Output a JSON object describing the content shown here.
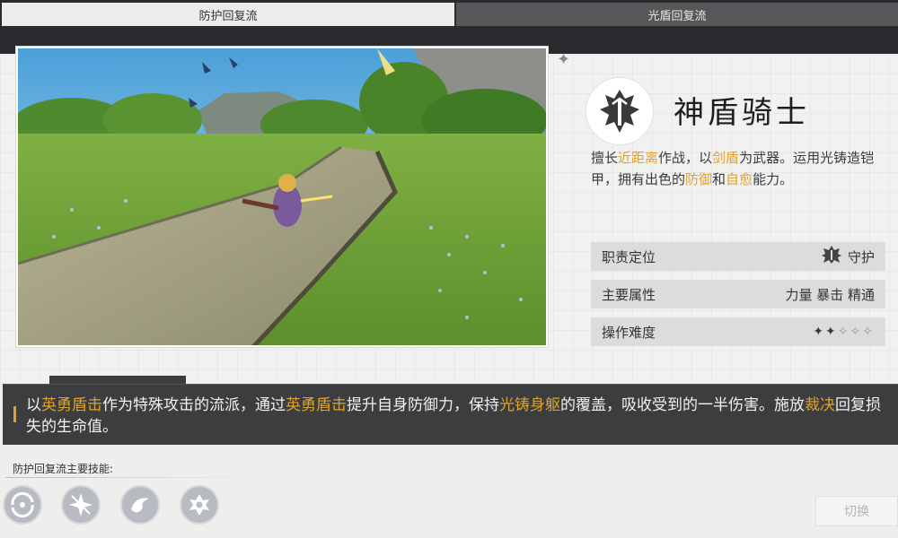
{
  "tabs": [
    {
      "label": "防护回复流",
      "active": true
    },
    {
      "label": "光盾回复流",
      "active": false
    }
  ],
  "decor": {
    "star": "✦"
  },
  "hero": {
    "name": "神盾骑士",
    "emblem_icon": "shield-sword-emblem-icon",
    "description_parts": [
      {
        "text": "擅长",
        "hl": false
      },
      {
        "text": "近距离",
        "hl": true
      },
      {
        "text": "作战，以",
        "hl": false
      },
      {
        "text": "剑盾",
        "hl": true
      },
      {
        "text": "为武器。运用光铸造铠甲，拥有出色的",
        "hl": false
      },
      {
        "text": "防御",
        "hl": true
      },
      {
        "text": "和",
        "hl": false
      },
      {
        "text": "自愈",
        "hl": true
      },
      {
        "text": "能力。",
        "hl": false
      }
    ]
  },
  "stats": [
    {
      "label": "职责定位",
      "value": "守护",
      "icon": "guard-icon"
    },
    {
      "label": "主要属性",
      "value": "力量 暴击 精通"
    },
    {
      "label": "操作难度",
      "difficulty": 2,
      "max": 5,
      "filled": "✦✦",
      "empty": "✧✧✧"
    }
  ],
  "flow_description_parts": [
    {
      "text": "以",
      "hl": false
    },
    {
      "text": "英勇盾击",
      "hl": true
    },
    {
      "text": "作为特殊攻击的流派，通过",
      "hl": false
    },
    {
      "text": "英勇盾击",
      "hl": true
    },
    {
      "text": "提升自身防御力，保持",
      "hl": false
    },
    {
      "text": "光铸身躯",
      "hl": true
    },
    {
      "text": "的覆盖，吸收受到的一半伤害。施放",
      "hl": false
    },
    {
      "text": "裁决",
      "hl": true
    },
    {
      "text": "回复损失的生命值。",
      "hl": false
    }
  ],
  "skills": {
    "label": "防护回复流主要技能:",
    "icons": [
      "whirl-slash-skill-icon",
      "star-burst-skill-icon",
      "swirl-strike-skill-icon",
      "radiant-guard-skill-icon"
    ]
  },
  "colors": {
    "highlight": "#e0a32a",
    "bar": "#3c3d3f"
  },
  "switch_label": "切换"
}
